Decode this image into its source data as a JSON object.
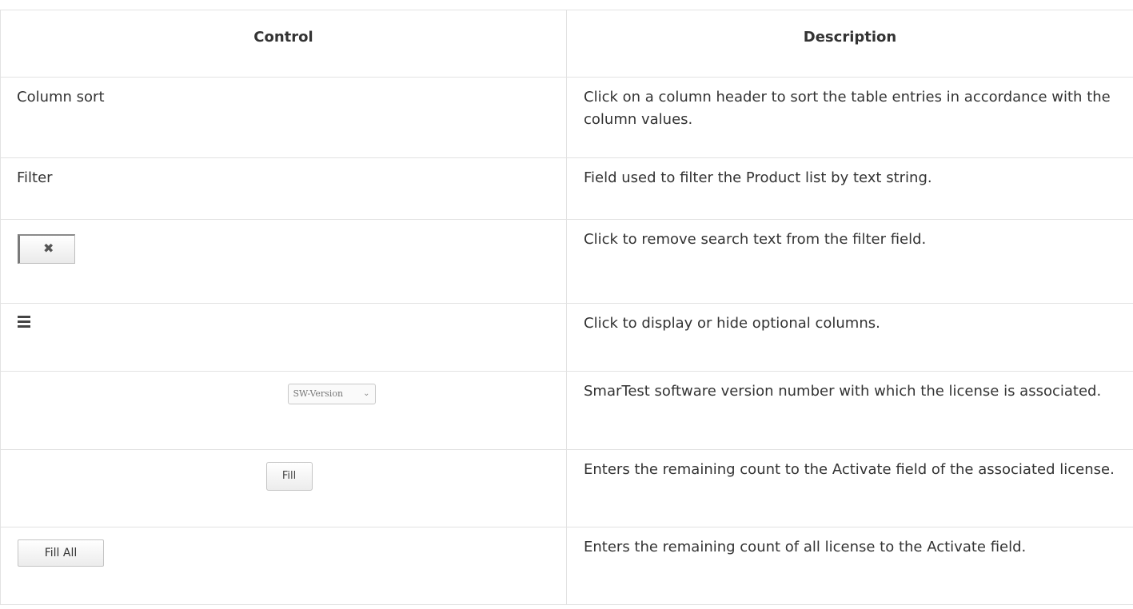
{
  "table": {
    "headers": {
      "control": "Control",
      "description": "Description"
    },
    "rows": [
      {
        "control": "Column sort",
        "description": "Click on a column header to sort the table entries in accordance with the column values."
      },
      {
        "control": "Filter",
        "description": "Field used to filter the Product list by text string."
      },
      {
        "control_icon": "clear-x-icon",
        "control_glyph": "✖",
        "description": "Click to remove search text from the filter field."
      },
      {
        "control_icon": "hamburger-menu-icon",
        "description": "Click to display or hide optional columns."
      },
      {
        "control_select_value": "SW-Version",
        "control_icon": "chevron-down-icon",
        "control_glyph": "⌵",
        "description": "SmarTest software version number with which the license is associated."
      },
      {
        "control_button": "Fill",
        "description": "Enters the remaining count to the Activate field of the associated license."
      },
      {
        "control_button": "Fill All",
        "description": "Enters the remaining count of all license to the Activate field."
      }
    ]
  }
}
